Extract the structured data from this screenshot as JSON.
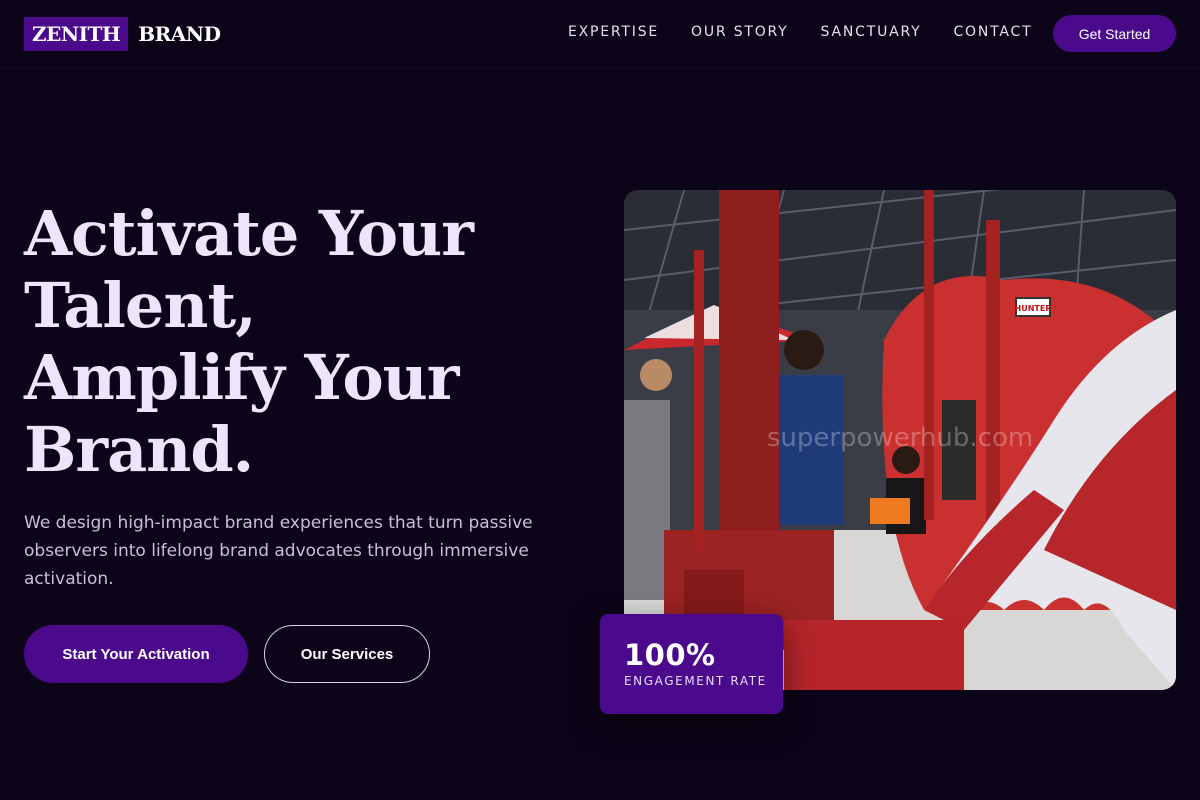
{
  "brand": {
    "box_text": "ZENITH",
    "rest_text": "BRAND"
  },
  "nav": {
    "items": [
      {
        "label": "EXPERTISE"
      },
      {
        "label": "OUR STORY"
      },
      {
        "label": "SANCTUARY"
      },
      {
        "label": "CONTACT"
      }
    ],
    "cta_label": "Get Started"
  },
  "hero": {
    "title_lines": [
      "Activate Your",
      "Talent,",
      "Amplify Your",
      "Brand."
    ],
    "subtitle": "We design high-impact brand experiences that turn passive observers into lifelong brand advocates through immersive activation.",
    "primary_button": "Start Your Activation",
    "secondary_button": "Our Services"
  },
  "image": {
    "description_icon": "event-photo-icon",
    "sign_text": "HUNTER",
    "watermark": "superpowerhub.com"
  },
  "stat": {
    "value": "100%",
    "label": "ENGAGEMENT RATE"
  },
  "colors": {
    "background": "#0c0418",
    "accent": "#4b0a8c",
    "title": "#ede6fb",
    "body_text": "#c9bfd8"
  }
}
